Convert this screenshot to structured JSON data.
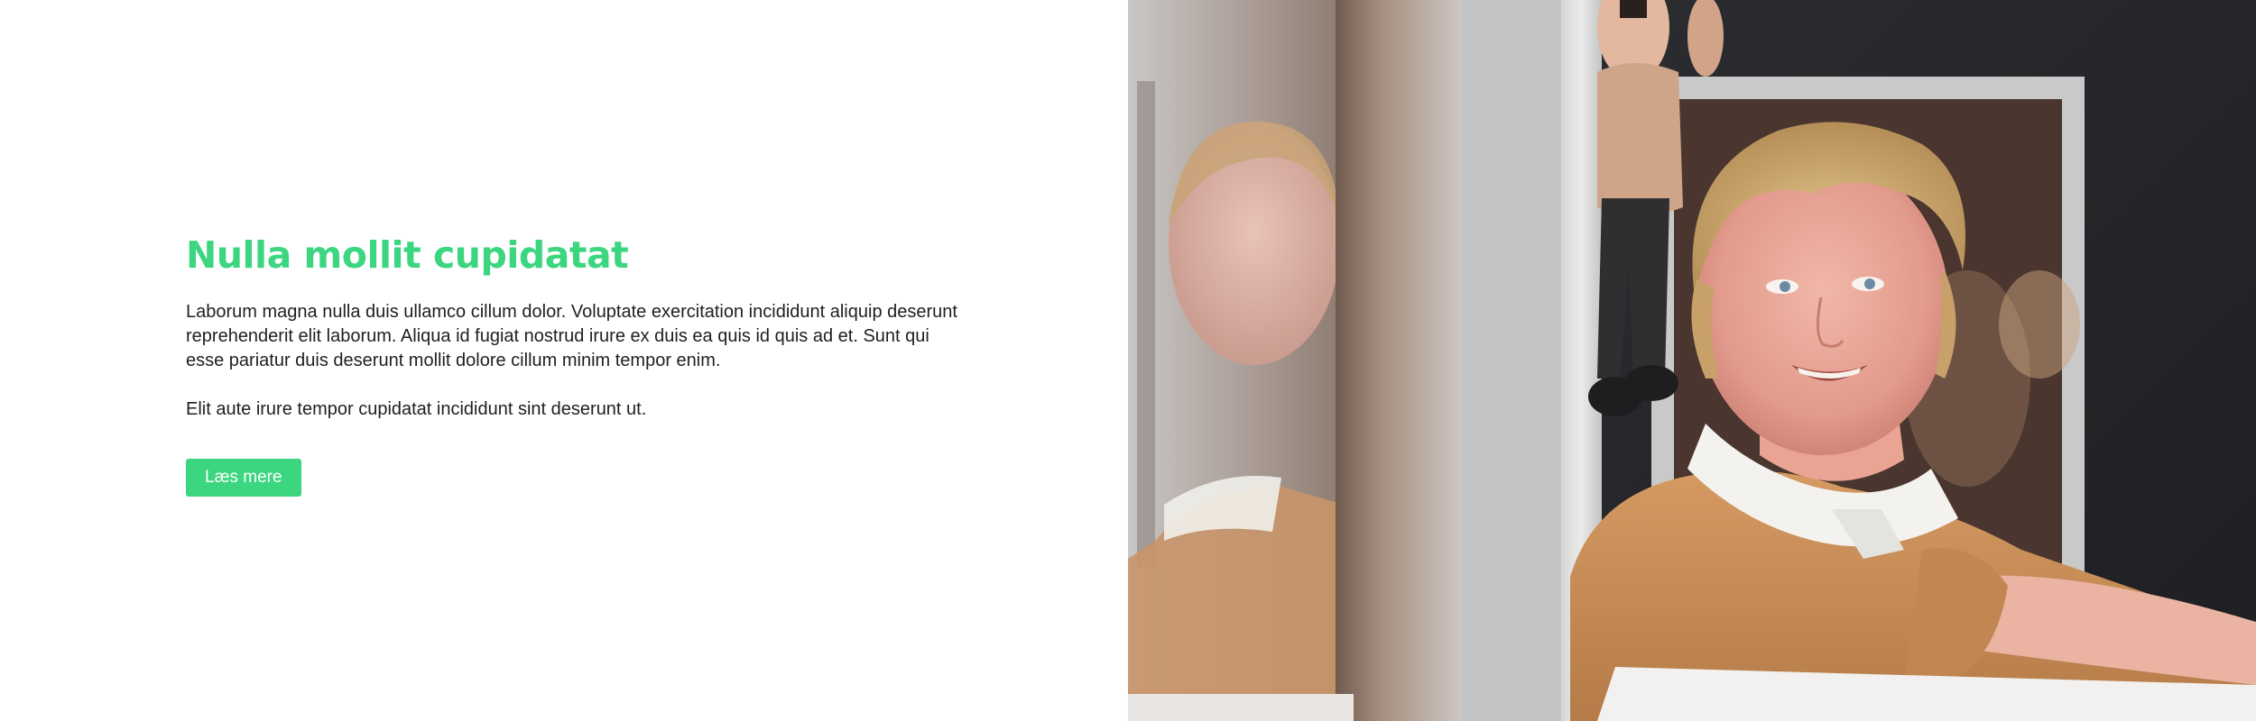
{
  "hero": {
    "heading": "Nulla mollit cupidatat",
    "paragraph_1": "Laborum magna nulla duis ullamco cillum dolor. Voluptate exercitation incididunt aliquip deserunt reprehenderit elit laborum. Aliqua id fugiat nostrud irure ex duis ea quis id quis ad et. Sunt qui esse pariatur duis deserunt mollit dolore cillum minim tempor enim.",
    "paragraph_2": "Elit aute irure tempor cupidatat incididunt sint deserunt ut.",
    "button_label": "Læs mere"
  },
  "colors": {
    "accent": "#3bd67f",
    "text": "#1f1f1f",
    "background": "#ffffff"
  }
}
